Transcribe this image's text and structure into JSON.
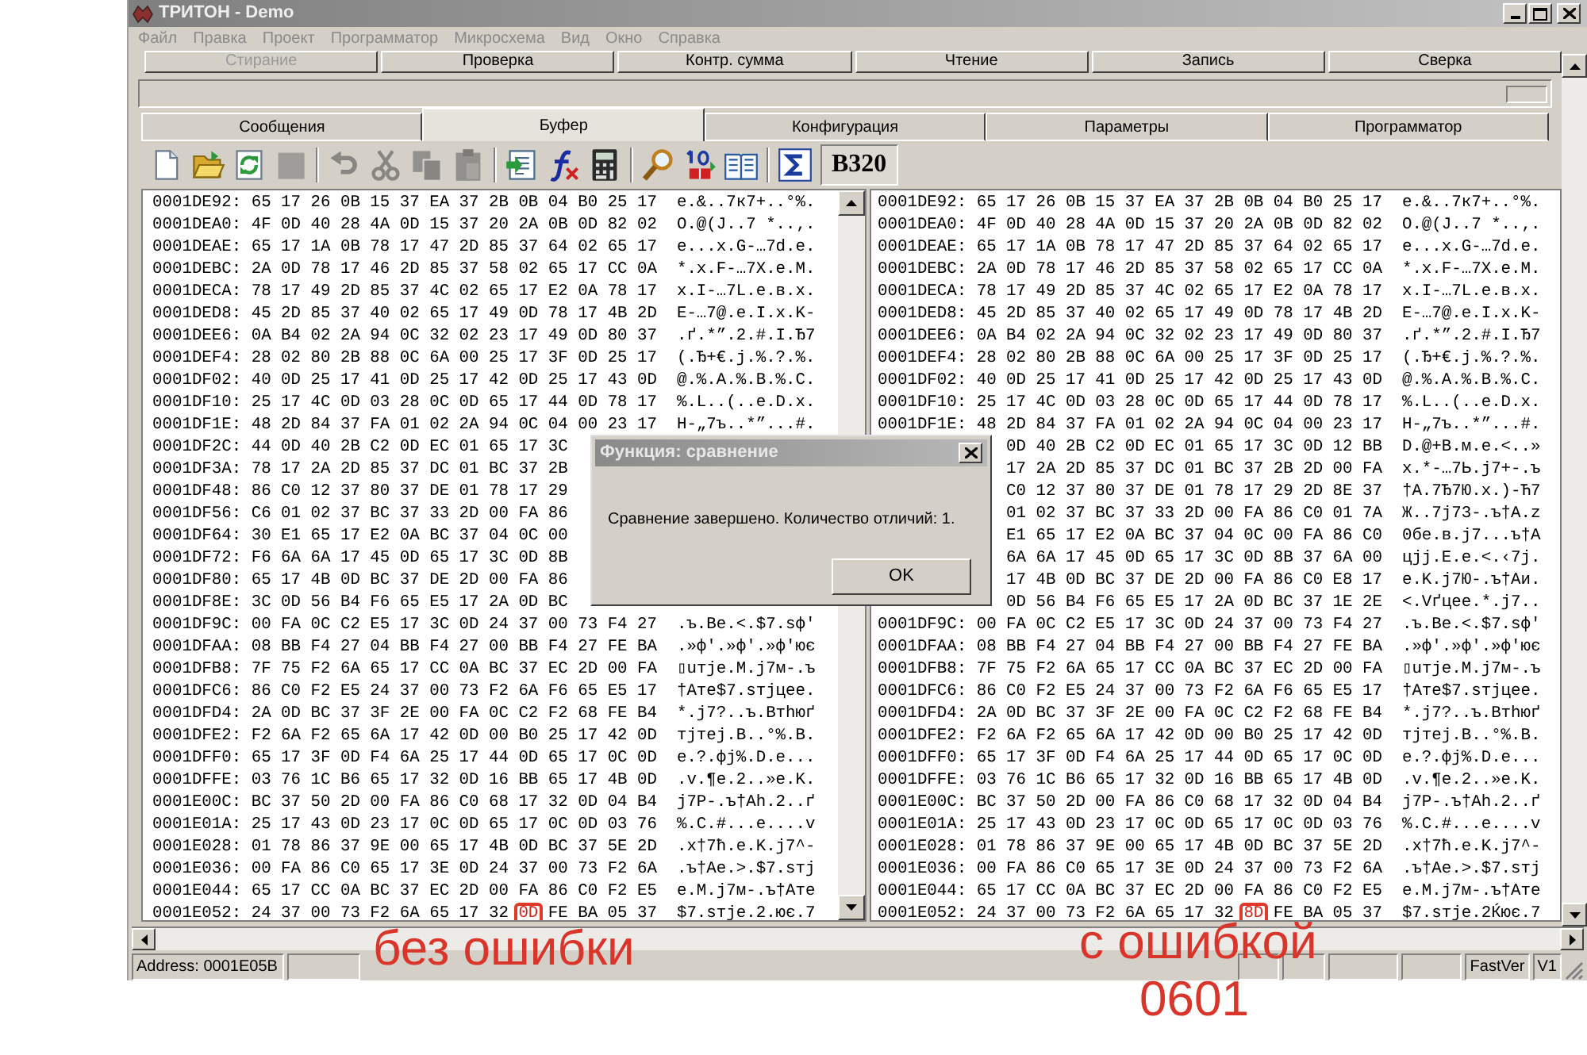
{
  "window": {
    "title": "ТРИТОН - Demo"
  },
  "menu": {
    "disabled": true,
    "items": [
      "Файл",
      "Правка",
      "Проект",
      "Программатор",
      "Микросхема",
      "Вид",
      "Окно",
      "Справка"
    ]
  },
  "action_buttons": [
    {
      "label": "Стирание",
      "disabled": true
    },
    {
      "label": "Проверка",
      "disabled": false
    },
    {
      "label": "Контр. сумма",
      "disabled": false
    },
    {
      "label": "Чтение",
      "disabled": false
    },
    {
      "label": "Запись",
      "disabled": false
    },
    {
      "label": "Сверка",
      "disabled": false
    }
  ],
  "tabs": [
    {
      "label": "Сообщения",
      "selected": false
    },
    {
      "label": "Буфер",
      "selected": true
    },
    {
      "label": "Конфигурация",
      "selected": false
    },
    {
      "label": "Параметры",
      "selected": false
    },
    {
      "label": "Программатор",
      "selected": false
    }
  ],
  "toolbar": [
    {
      "kind": "icon",
      "disabled": false
    },
    {
      "kind": "icon",
      "disabled": false
    },
    {
      "kind": "icon",
      "disabled": false
    },
    {
      "kind": "icon",
      "disabled": true
    },
    {
      "kind": "separator"
    },
    {
      "kind": "icon",
      "disabled": true
    },
    {
      "kind": "icon",
      "disabled": true
    },
    {
      "kind": "icon",
      "disabled": true
    },
    {
      "kind": "icon",
      "disabled": true
    },
    {
      "kind": "separator"
    },
    {
      "kind": "icon",
      "disabled": false
    },
    {
      "kind": "icon",
      "disabled": false
    },
    {
      "kind": "icon",
      "disabled": false
    },
    {
      "kind": "separator"
    },
    {
      "kind": "icon",
      "disabled": false
    },
    {
      "kind": "icon",
      "disabled": false
    },
    {
      "kind": "icon",
      "disabled": false
    },
    {
      "kind": "separator"
    },
    {
      "kind": "icon",
      "disabled": false
    },
    {
      "kind": "label",
      "label": "B320"
    }
  ],
  "left_pane": {
    "rows": [
      {
        "address": "0001DE92:",
        "hex": "65 17 26 0B 15 37 EA 37 2B 0B 04 B0 25 17",
        "ascii": "e.&..7к7+..°%."
      },
      {
        "address": "0001DEA0:",
        "hex": "4F 0D 40 28 4A 0D 15 37 20 2A 0B 0D 82 02",
        "ascii": "O.@(J..7 *..‚."
      },
      {
        "address": "0001DEAE:",
        "hex": "65 17 1A 0B 78 17 47 2D 85 37 64 02 65 17",
        "ascii": "e...x.G-…7d.e."
      },
      {
        "address": "0001DEBC:",
        "hex": "2A 0D 78 17 46 2D 85 37 58 02 65 17 CC 0A",
        "ascii": "*.x.F-…7X.e.М."
      },
      {
        "address": "0001DECA:",
        "hex": "78 17 49 2D 85 37 4C 02 65 17 E2 0A 78 17",
        "ascii": "x.I-…7L.e.в.x."
      },
      {
        "address": "0001DED8:",
        "hex": "45 2D 85 37 40 02 65 17 49 0D 78 17 4B 2D",
        "ascii": "E-…7@.e.I.x.K-"
      },
      {
        "address": "0001DEE6:",
        "hex": "0A B4 02 2A 94 0C 32 02 23 17 49 0D 80 37",
        "ascii": ".ґ.*”.2.#.I.Ђ7"
      },
      {
        "address": "0001DEF4:",
        "hex": "28 02 80 2B 88 0C 6A 00 25 17 3F 0D 25 17",
        "ascii": "(.Ђ+€.j.%.?.%."
      },
      {
        "address": "0001DF02:",
        "hex": "40 0D 25 17 41 0D 25 17 42 0D 25 17 43 0D",
        "ascii": "@.%.A.%.B.%.C."
      },
      {
        "address": "0001DF10:",
        "hex": "25 17 4C 0D 03 28 0C 0D 65 17 44 0D 78 17",
        "ascii": "%.L..(..e.D.x."
      },
      {
        "address": "0001DF1E:",
        "hex": "48 2D 84 37 FA 01 02 2A 94 0C 04 00 23 17",
        "ascii": "H-„7ъ..*”...#."
      },
      {
        "address": "0001DF2C:",
        "hex": "44 0D 40 2B C2 0D EC 01 65 17 3C"
      },
      {
        "address": "0001DF3A:",
        "hex": "78 17 2A 2D 85 37 DC 01 BC 37 2B"
      },
      {
        "address": "0001DF48:",
        "hex": "86 C0 12 37 80 37 DE 01 78 17 29"
      },
      {
        "address": "0001DF56:",
        "hex": "C6 01 02 37 BC 37 33 2D 00 FA 86"
      },
      {
        "address": "0001DF64:",
        "hex": "30 E1 65 17 E2 0A BC 37 04 0C 00"
      },
      {
        "address": "0001DF72:",
        "hex": "F6 6A 6A 17 45 0D 65 17 3C 0D 8B"
      },
      {
        "address": "0001DF80:",
        "hex": "65 17 4B 0D BC 37 DE 2D 00 FA 86"
      },
      {
        "address": "0001DF8E:",
        "hex": "3C 0D 56 B4 F6 65 E5 17 2A 0D BC"
      },
      {
        "address": "0001DF9C:",
        "hex": "00 FA 0C C2 E5 17 3C 0D 24 37 00 73 F4 27",
        "ascii": ".ъ.Ве.<.$7.sф'"
      },
      {
        "address": "0001DFAA:",
        "hex": "08 BB F4 27 04 BB F4 27 00 BB F4 27 FE BA",
        "ascii": ".»ф'.»ф'.»ф'ює"
      },
      {
        "address": "0001DFB8:",
        "hex": "7F 75 F2 6A 65 17 CC 0A BC 37 EC 2D 00 FA",
        "ascii": "▯uтje.М.j7м-.ъ"
      },
      {
        "address": "0001DFC6:",
        "hex": "86 C0 F2 E5 24 37 00 73 F2 6A F6 65 E5 17",
        "ascii": "†Ате$7.sтjцeе."
      },
      {
        "address": "0001DFD4:",
        "hex": "2A 0D BC 37 3F 2E 00 FA 0C C2 F2 68 FE B4",
        "ascii": "*.j7?..ъ.Втhюґ"
      },
      {
        "address": "0001DFE2:",
        "hex": "F2 6A F2 65 6A 17 42 0D 00 B0 25 17 42 0D",
        "ascii": "тjтej.B..°%.B."
      },
      {
        "address": "0001DFF0:",
        "hex": "65 17 3F 0D F4 6A 25 17 44 0D 65 17 0C 0D",
        "ascii": "e.?.фj%.D.e..."
      },
      {
        "address": "0001DFFE:",
        "hex": "03 76 1C B6 65 17 32 0D 16 BB 65 17 4B 0D",
        "ascii": ".v.¶e.2..»e.K."
      },
      {
        "address": "0001E00C:",
        "hex": "BC 37 50 2D 00 FA 86 C0 68 17 32 0D 04 B4",
        "ascii": "j7P-.ъ†Аh.2..ґ"
      },
      {
        "address": "0001E01A:",
        "hex": "25 17 43 0D 23 17 0C 0D 65 17 0C 0D 03 76",
        "ascii": "%.C.#...e....v"
      },
      {
        "address": "0001E028:",
        "hex": "01 78 86 37 9E 00 65 17 4B 0D BC 37 5E 2D",
        "ascii": ".x†7ћ.e.K.j7^-"
      },
      {
        "address": "0001E036:",
        "hex": "00 FA 86 C0 65 17 3E 0D 24 37 00 73 F2 6A",
        "ascii": ".ъ†Аe.>.$7.sтj"
      },
      {
        "address": "0001E044:",
        "hex": "65 17 CC 0A BC 37 EC 2D 00 FA 86 C0 F2 E5",
        "ascii": "e.М.j7м-.ъ†Ате"
      },
      {
        "address": "0001E052:",
        "hex": [
          {
            "text": "24 37 00 73 F2 6A 65 17 32",
            "circled": false
          },
          {
            "text": "0D",
            "circled": true
          },
          {
            "text": "FE BA 05 37",
            "circled": false
          }
        ],
        "ascii": "$7.sтje.2.ює.7"
      }
    ]
  },
  "right_pane": {
    "rows": [
      {
        "address": "0001DE92:",
        "hex": "65 17 26 0B 15 37 EA 37 2B 0B 04 B0 25 17",
        "ascii": "e.&..7к7+..°%."
      },
      {
        "address": "0001DEA0:",
        "hex": "4F 0D 40 28 4A 0D 15 37 20 2A 0B 0D 82 02",
        "ascii": "O.@(J..7 *..‚."
      },
      {
        "address": "0001DEAE:",
        "hex": "65 17 1A 0B 78 17 47 2D 85 37 64 02 65 17",
        "ascii": "e...x.G-…7d.e."
      },
      {
        "address": "0001DEBC:",
        "hex": "2A 0D 78 17 46 2D 85 37 58 02 65 17 CC 0A",
        "ascii": "*.x.F-…7X.e.М."
      },
      {
        "address": "0001DECA:",
        "hex": "78 17 49 2D 85 37 4C 02 65 17 E2 0A 78 17",
        "ascii": "x.I-…7L.e.в.x."
      },
      {
        "address": "0001DED8:",
        "hex": "45 2D 85 37 40 02 65 17 49 0D 78 17 4B 2D",
        "ascii": "E-…7@.e.I.x.K-"
      },
      {
        "address": "0001DEE6:",
        "hex": "0A B4 02 2A 94 0C 32 02 23 17 49 0D 80 37",
        "ascii": ".ґ.*”.2.#.I.Ђ7"
      },
      {
        "address": "0001DEF4:",
        "hex": "28 02 80 2B 88 0C 6A 00 25 17 3F 0D 25 17",
        "ascii": "(.Ђ+€.j.%.?.%."
      },
      {
        "address": "0001DF02:",
        "hex": "40 0D 25 17 41 0D 25 17 42 0D 25 17 43 0D",
        "ascii": "@.%.A.%.B.%.C."
      },
      {
        "address": "0001DF10:",
        "hex": "25 17 4C 0D 03 28 0C 0D 65 17 44 0D 78 17",
        "ascii": "%.L..(..e.D.x."
      },
      {
        "address": "0001DF1E:",
        "hex": "48 2D 84 37 FA 01 02 2A 94 0C 04 00 23 17",
        "ascii": "H-„7ъ..*”...#."
      },
      {
        "hex": "0D 40 2B C2 0D EC 01 65 17 3C 0D 12 BB",
        "ascii": "D.@+B.м.e.<..»"
      },
      {
        "hex": "17 2A 2D 85 37 DC 01 BC 37 2B 2D 00 FA",
        "ascii": "x.*-…7Ь.j7+-.ъ"
      },
      {
        "hex": "C0 12 37 80 37 DE 01 78 17 29 2D 8E 37",
        "ascii": "†А.7Ђ7Ю.x.)-Ћ7"
      },
      {
        "hex": "01 02 37 BC 37 33 2D 00 FA 86 C0 01 7A",
        "ascii": "Ж..7j73-.ъ†А.z"
      },
      {
        "hex": "E1 65 17 E2 0A BC 37 04 0C 00 FA 86 C0",
        "ascii": "0бe.в.j7...ъ†А"
      },
      {
        "hex": "6A 6A 17 45 0D 65 17 3C 0D 8B 37 6A 00",
        "ascii": "цjj.E.e.<.‹7j."
      },
      {
        "hex": "17 4B 0D BC 37 DE 2D 00 FA 86 C0 E8 17",
        "ascii": "e.K.j7Ю-.ъ†Аи."
      },
      {
        "hex": "0D 56 B4 F6 65 E5 17 2A 0D BC 37 1E 2E",
        "ascii": "<.Vґцeе.*.j7.."
      },
      {
        "address": "0001DF9C:",
        "hex": "00 FA 0C C2 E5 17 3C 0D 24 37 00 73 F4 27",
        "ascii": ".ъ.Ве.<.$7.sф'"
      },
      {
        "address": "0001DFAA:",
        "hex": "08 BB F4 27 04 BB F4 27 00 BB F4 27 FE BA",
        "ascii": ".»ф'.»ф'.»ф'ює"
      },
      {
        "address": "0001DFB8:",
        "hex": "7F 75 F2 6A 65 17 CC 0A BC 37 EC 2D 00 FA",
        "ascii": "▯uтje.М.j7м-.ъ"
      },
      {
        "address": "0001DFC6:",
        "hex": "86 C0 F2 E5 24 37 00 73 F2 6A F6 65 E5 17",
        "ascii": "†Ате$7.sтjцeе."
      },
      {
        "address": "0001DFD4:",
        "hex": "2A 0D BC 37 3F 2E 00 FA 0C C2 F2 68 FE B4",
        "ascii": "*.j7?..ъ.Втhюґ"
      },
      {
        "address": "0001DFE2:",
        "hex": "F2 6A F2 65 6A 17 42 0D 00 B0 25 17 42 0D",
        "ascii": "тjтej.B..°%.B."
      },
      {
        "address": "0001DFF0:",
        "hex": "65 17 3F 0D F4 6A 25 17 44 0D 65 17 0C 0D",
        "ascii": "e.?.фj%.D.e..."
      },
      {
        "address": "0001DFFE:",
        "hex": "03 76 1C B6 65 17 32 0D 16 BB 65 17 4B 0D",
        "ascii": ".v.¶e.2..»e.K."
      },
      {
        "address": "0001E00C:",
        "hex": "BC 37 50 2D 00 FA 86 C0 68 17 32 0D 04 B4",
        "ascii": "j7P-.ъ†Аh.2..ґ"
      },
      {
        "address": "0001E01A:",
        "hex": "25 17 43 0D 23 17 0C 0D 65 17 0C 0D 03 76",
        "ascii": "%.C.#...e....v"
      },
      {
        "address": "0001E028:",
        "hex": "01 78 86 37 9E 00 65 17 4B 0D BC 37 5E 2D",
        "ascii": ".x†7ћ.e.K.j7^-"
      },
      {
        "address": "0001E036:",
        "hex": "00 FA 86 C0 65 17 3E 0D 24 37 00 73 F2 6A",
        "ascii": ".ъ†Аe.>.$7.sтj"
      },
      {
        "address": "0001E044:",
        "hex": "65 17 CC 0A BC 37 EC 2D 00 FA 86 C0 F2 E5",
        "ascii": "e.М.j7м-.ъ†Ате"
      },
      {
        "address": "0001E052:",
        "hex": [
          {
            "text": "24 37 00 73 F2 6A 65 17 32",
            "circled": false
          },
          {
            "text": "8D",
            "circled": true
          },
          {
            "text": "FE BA 05 37",
            "circled": false
          }
        ],
        "ascii": "$7.sтje.2Ќює.7"
      }
    ]
  },
  "dialog": {
    "title": "Функция: сравнение",
    "message": "Сравнение завершено. Количество отличий: 1.",
    "button": "OK"
  },
  "status_bar": {
    "address": "Address: 0001E05B",
    "mode": "FastVer",
    "version": "V1"
  },
  "annotations": [
    {
      "text": "без ошибки"
    },
    {
      "text": "с ошибкой"
    },
    {
      "text": "0601"
    }
  ]
}
